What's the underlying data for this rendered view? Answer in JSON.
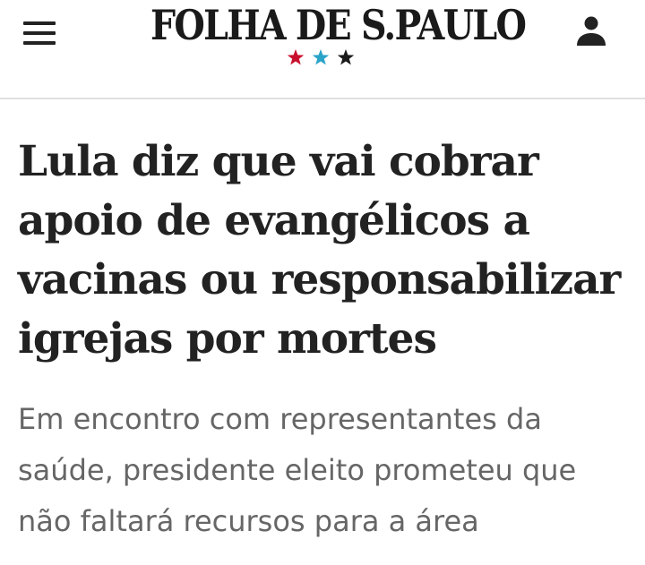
{
  "header": {
    "logo_text": "FOLHA DE S.PAULO",
    "menu_icon": "hamburger-menu-icon",
    "account_icon": "user-account-icon",
    "star_colors": [
      "#c8102e",
      "#2aa3c9",
      "#1a1a1a"
    ]
  },
  "article": {
    "headline": "Lula diz que vai cobrar apoio de evangélicos a vacinas ou responsabilizar igrejas por mortes",
    "subtitle": "Em encontro com representantes da saúde, presidente eleito prometeu que não faltará recursos para a área"
  }
}
